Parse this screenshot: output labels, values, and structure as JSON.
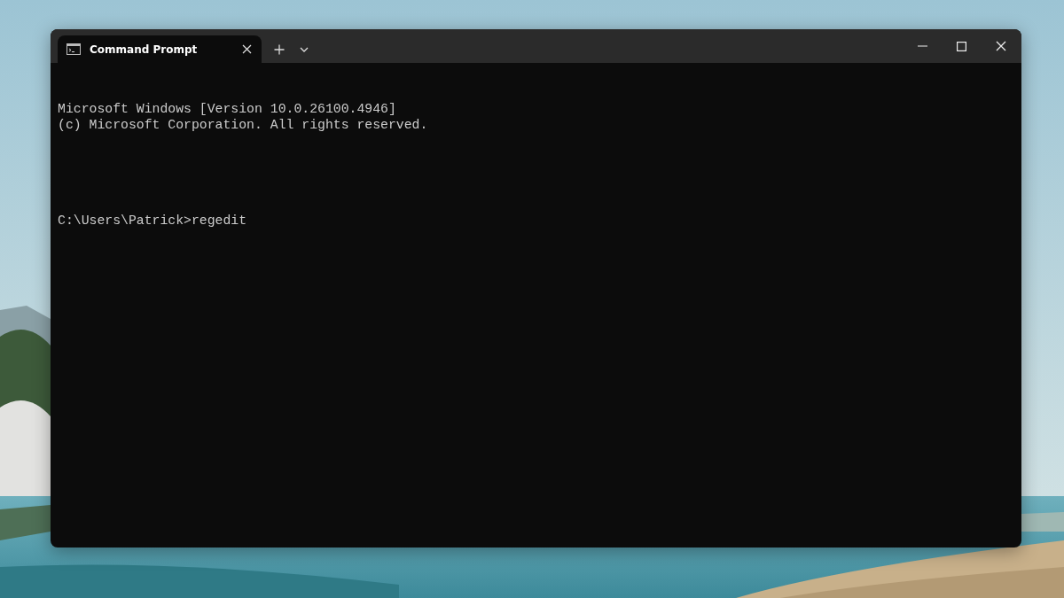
{
  "tabs": [
    {
      "title": "Command Prompt",
      "selected": true
    }
  ],
  "console": {
    "output": [
      "Microsoft Windows [Version 10.0.26100.4946]",
      "(c) Microsoft Corporation. All rights reserved."
    ],
    "prompt_line": "C:\\Users\\Patrick>regedit"
  }
}
